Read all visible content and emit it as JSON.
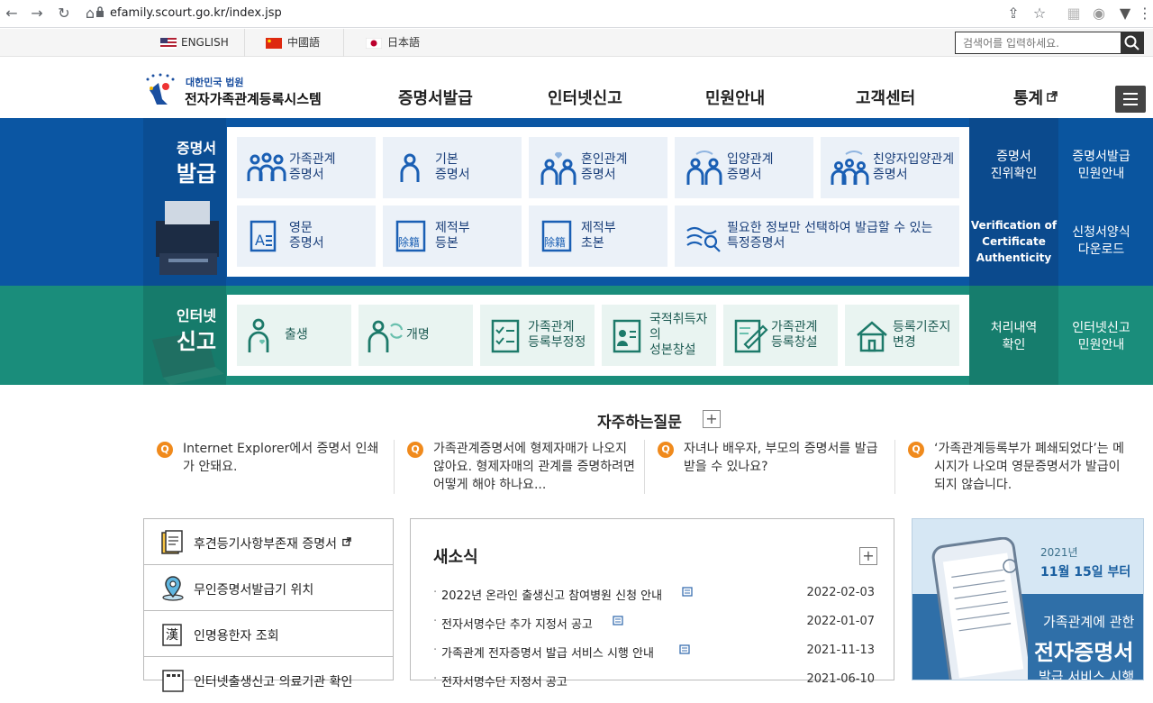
{
  "browser": {
    "url": "efamily.scourt.go.kr/index.jsp"
  },
  "topbar": {
    "languages": [
      "ENGLISH",
      "中國語",
      "日本語"
    ],
    "search_placeholder": "검색어를 입력하세요."
  },
  "header": {
    "logo_top": "대한민국 법원",
    "logo_main": "전자가족관계등록시스템",
    "nav": [
      "증명서발급",
      "인터넷신고",
      "민원안내",
      "고객센터",
      "통계"
    ]
  },
  "issue": {
    "title_top": "증명서",
    "title_main": "발급",
    "tiles": [
      {
        "l1": "가족관계",
        "l2": "증명서"
      },
      {
        "l1": "기본",
        "l2": "증명서"
      },
      {
        "l1": "혼인관계",
        "l2": "증명서"
      },
      {
        "l1": "입양관계",
        "l2": "증명서"
      },
      {
        "l1": "친양자입양관계",
        "l2": "증명서"
      },
      {
        "l1": "영문",
        "l2": "증명서"
      },
      {
        "l1": "제적부",
        "l2": "등본"
      },
      {
        "l1": "제적부",
        "l2": "초본"
      },
      {
        "l1": "필요한 정보만 선택하여 발급할 수 있는",
        "l2": "특정증명서"
      }
    ],
    "side": [
      {
        "l1": "증명서",
        "l2": "진위확인"
      },
      {
        "l1": "증명서발급",
        "l2": "민원안내"
      },
      {
        "l1": "Verification of",
        "l2": "Certificate",
        "l3": "Authenticity"
      },
      {
        "l1": "신청서양식",
        "l2": "다운로드"
      }
    ]
  },
  "report": {
    "title_top": "인터넷",
    "title_main": "신고",
    "tiles": [
      {
        "l1": "출생",
        "l2": ""
      },
      {
        "l1": "개명",
        "l2": ""
      },
      {
        "l1": "가족관계",
        "l2": "등록부정정"
      },
      {
        "l1": "국적취득자의",
        "l2": "성본창설"
      },
      {
        "l1": "가족관계",
        "l2": "등록창설"
      },
      {
        "l1": "등록기준지",
        "l2": "변경"
      }
    ],
    "side": [
      {
        "l1": "처리내역",
        "l2": "확인"
      },
      {
        "l1": "인터넷신고",
        "l2": "민원안내"
      }
    ]
  },
  "faq": {
    "title": "자주하는질문",
    "plus": "+",
    "q_badge": "Q",
    "items": [
      "Internet Explorer에서 증명서 인쇄가 안돼요.",
      "가족관계증명서에 형제자매가 나오지 않아요. 형제자매의 관계를 증명하려면 어떻게 해야 하나요...",
      "자녀나 배우자, 부모의 증명서를 발급 받을 수 있나요?",
      "‘가족관계등록부가 폐쇄되었다’는 메시지가 나오며 영문증명서가 발급이 되지 않습니다."
    ]
  },
  "quick": {
    "items": [
      "후견등기사항부존재 증명서",
      "무인증명서발급기 위치",
      "인명용한자 조회",
      "인터넷출생신고 의료기관 확인"
    ]
  },
  "news": {
    "title": "새소식",
    "plus": "+",
    "bullet": "·",
    "items": [
      {
        "title": "2022년 온라인 출생신고 참여병원 신청 안내",
        "date": "2022-02-03"
      },
      {
        "title": "전자서명수단 추가 지정서 공고",
        "date": "2022-01-07"
      },
      {
        "title": "가족관계 전자증명서 발급 서비스 시행 안내",
        "date": "2021-11-13"
      },
      {
        "title": "전자서명수단 지정서 공고",
        "date": "2021-06-10"
      }
    ]
  },
  "banner": {
    "year": "2021년",
    "date": "11월 15일 부터",
    "line1": "가족관계에 관한",
    "line2": "전자증명서",
    "line3": "발급 서비스 시행"
  },
  "colors": {
    "blue_band": "#0b56a3",
    "green_band": "#1a8d7b",
    "faq_badge": "#f08a1c"
  }
}
